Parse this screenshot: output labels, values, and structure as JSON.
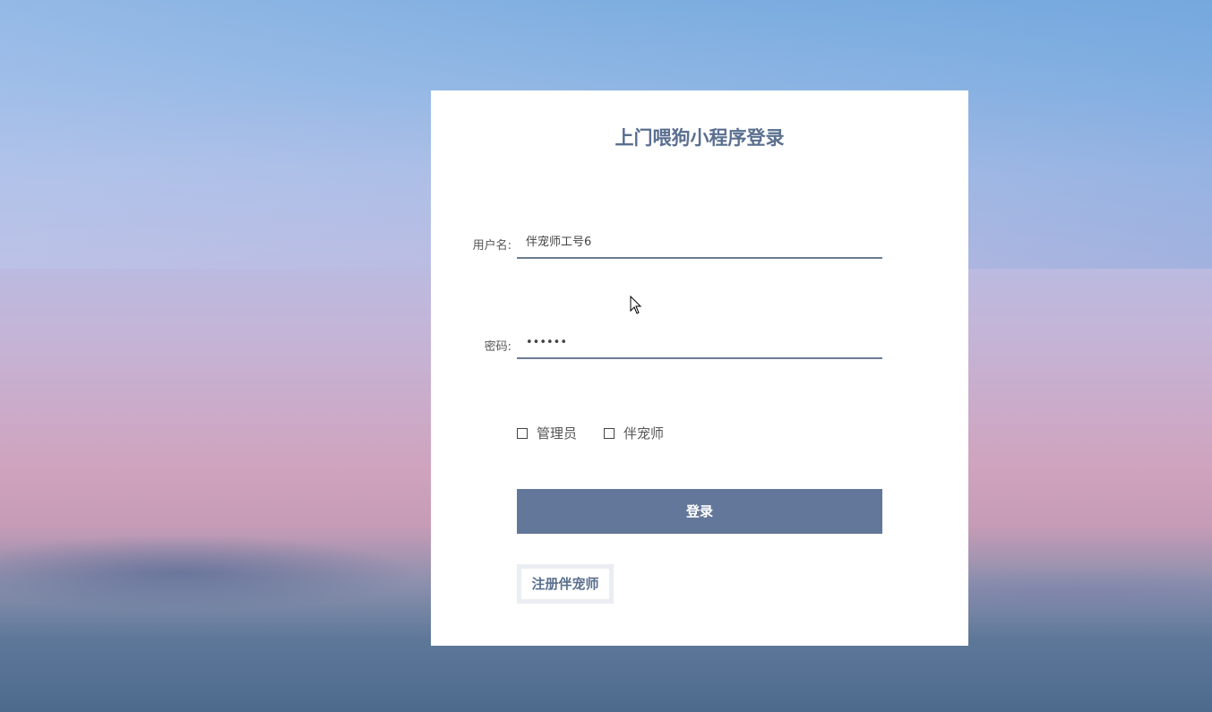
{
  "login": {
    "title": "上门喂狗小程序登录",
    "username_label": "用户名:",
    "username_value": "伴宠师工号6",
    "password_label": "密码:",
    "password_value": "••••••",
    "roles": [
      {
        "label": "管理员",
        "checked": false
      },
      {
        "label": "伴宠师",
        "checked": false
      }
    ],
    "login_button": "登录",
    "register_button": "注册伴宠师"
  },
  "colors": {
    "accent": "#63779a",
    "title": "#5a6f8f"
  },
  "icons": {
    "cursor": "mouse-pointer-icon"
  }
}
